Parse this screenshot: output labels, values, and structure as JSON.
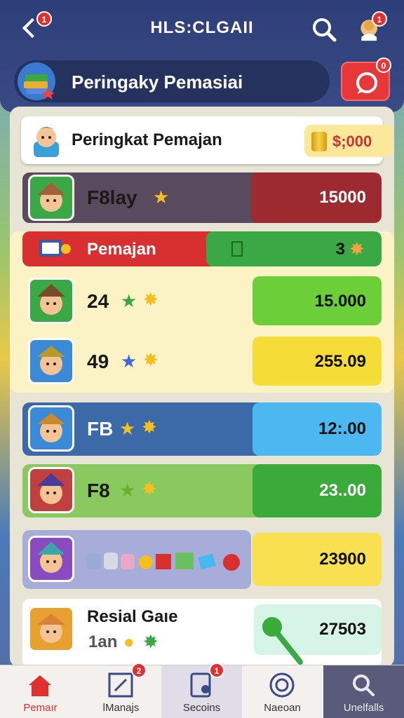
{
  "header": {
    "back_badge": "1",
    "title": "HLS:CLGAII",
    "profile_badge": "1",
    "title_pill_text": "Peringaky Pemasiai",
    "chat_badge": "0"
  },
  "leaderboard": {
    "header_title": "Peringkat Pemajan",
    "header_coins": "$;000",
    "rows": [
      {
        "name": "F8lay",
        "score": "15000",
        "left_color": "#5a4a5e",
        "right_color": "#9c2a30"
      },
      {
        "name": "Pemajan",
        "score": "3",
        "left_color": "#d83030",
        "right_color": "#3aa844"
      },
      {
        "name": "24",
        "score": "15.000",
        "left_color": "#fbf2c6",
        "right_color": "#6ccf3a"
      },
      {
        "name": "49",
        "score": "255.09",
        "left_color": "#fbf2c6",
        "right_color": "#f6dc36"
      },
      {
        "name": "FB",
        "score": "12:.00",
        "left_color": "#3c6aa8",
        "right_color": "#4cb8f0"
      },
      {
        "name": "F8",
        "score": "23..00",
        "left_color": "#8ac860",
        "right_color": "#3aaa3a"
      },
      {
        "name": "",
        "score": "23900",
        "left_color": "#a8acd8",
        "right_color": "#f8e050"
      },
      {
        "name": "Resial Gaıe",
        "sub": "1an",
        "score": "27503",
        "left_color": "#ffffff",
        "right_color": "#d6f5e6"
      }
    ]
  },
  "bottom_nav": [
    {
      "label": "Pemaır",
      "badge": "",
      "active": true
    },
    {
      "label": "lManajs",
      "badge": "2",
      "active": false
    },
    {
      "label": "Secoins",
      "badge": "1",
      "active": false
    },
    {
      "label": "Naeoan",
      "badge": "",
      "active": false
    },
    {
      "label": "Unelfalls",
      "badge": "",
      "active": false
    }
  ],
  "colors": {
    "top_bar": "#2e3e78",
    "accent_red": "#e63838",
    "coin_text": "#cc3333"
  }
}
